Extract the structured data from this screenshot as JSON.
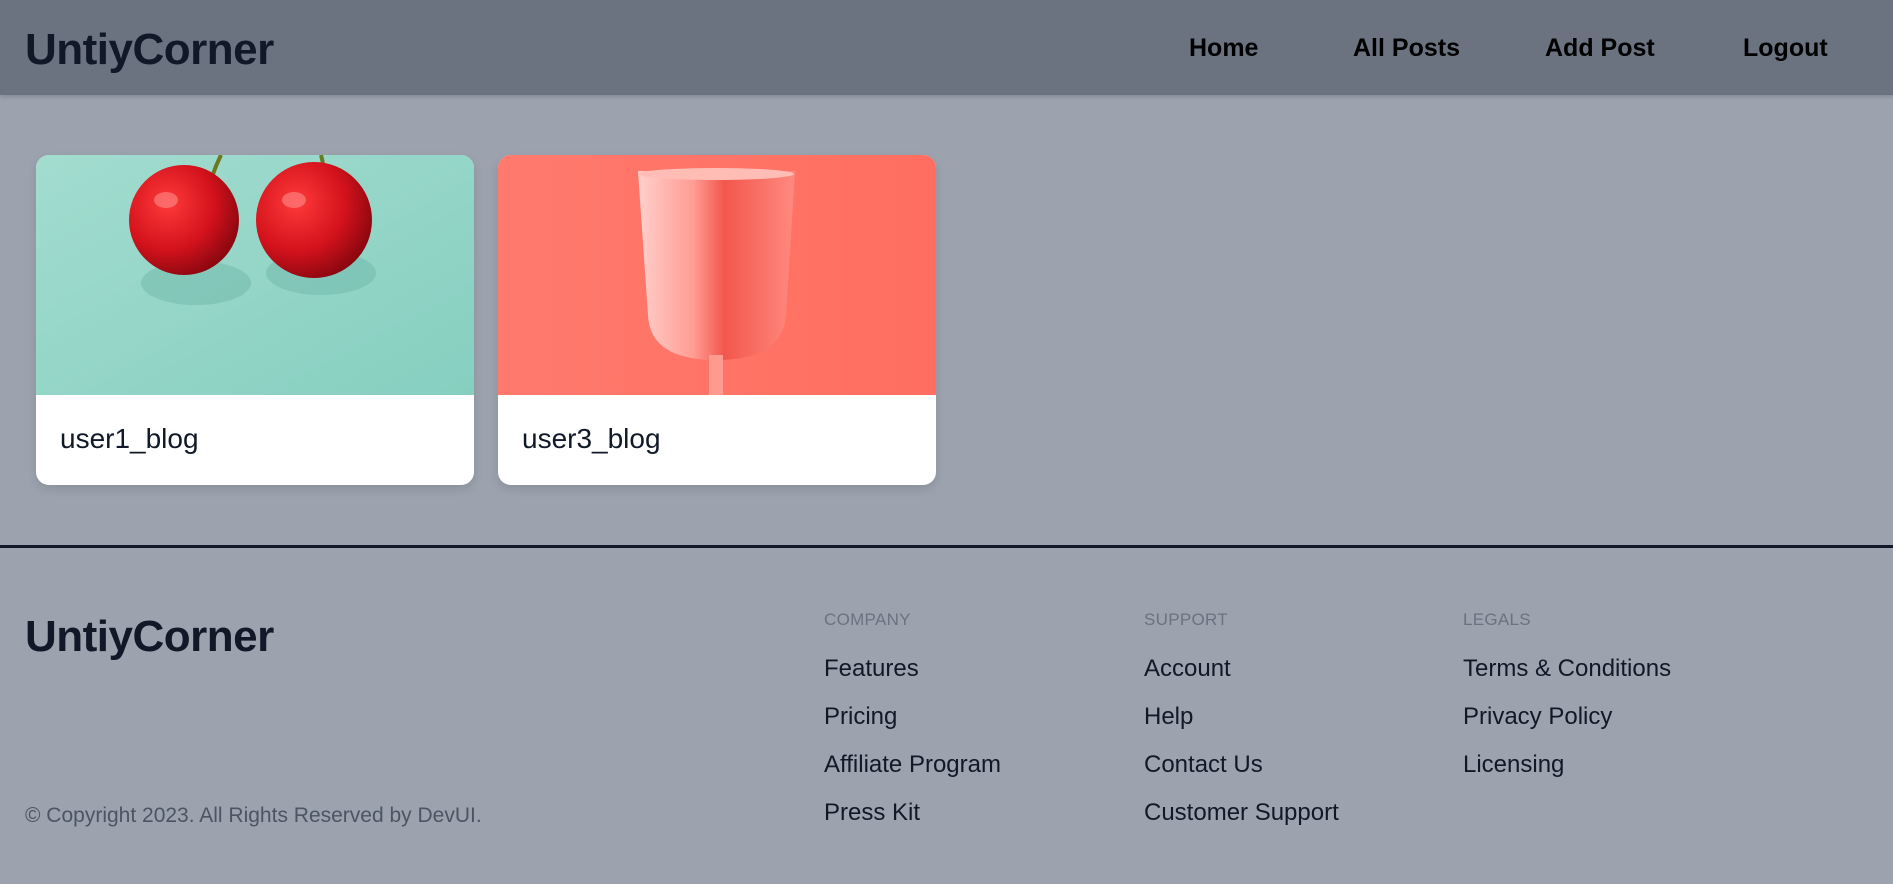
{
  "navbar": {
    "brand": "UntiyCorner",
    "links": [
      "Home",
      "All Posts",
      "Add Post",
      "Logout"
    ]
  },
  "posts": [
    {
      "title": "user1_blog",
      "image": "cherries-on-teal",
      "image_bg": "#9bd8cb"
    },
    {
      "title": "user3_blog",
      "image": "pink-cup-on-coral",
      "image_bg": "#ff7466"
    }
  ],
  "footer": {
    "brand": "UntiyCorner",
    "copyright": "© Copyright 2023. All Rights Reserved by DevUI.",
    "columns": [
      {
        "heading": "COMPANY",
        "links": [
          "Features",
          "Pricing",
          "Affiliate Program",
          "Press Kit"
        ]
      },
      {
        "heading": "SUPPORT",
        "links": [
          "Account",
          "Help",
          "Contact Us",
          "Customer Support"
        ]
      },
      {
        "heading": "LEGALS",
        "links": [
          "Terms & Conditions",
          "Privacy Policy",
          "Licensing"
        ]
      }
    ]
  },
  "colors": {
    "page_bg": "#9ca3af",
    "navbar_bg": "#6b7280",
    "text_dark": "#111827"
  }
}
